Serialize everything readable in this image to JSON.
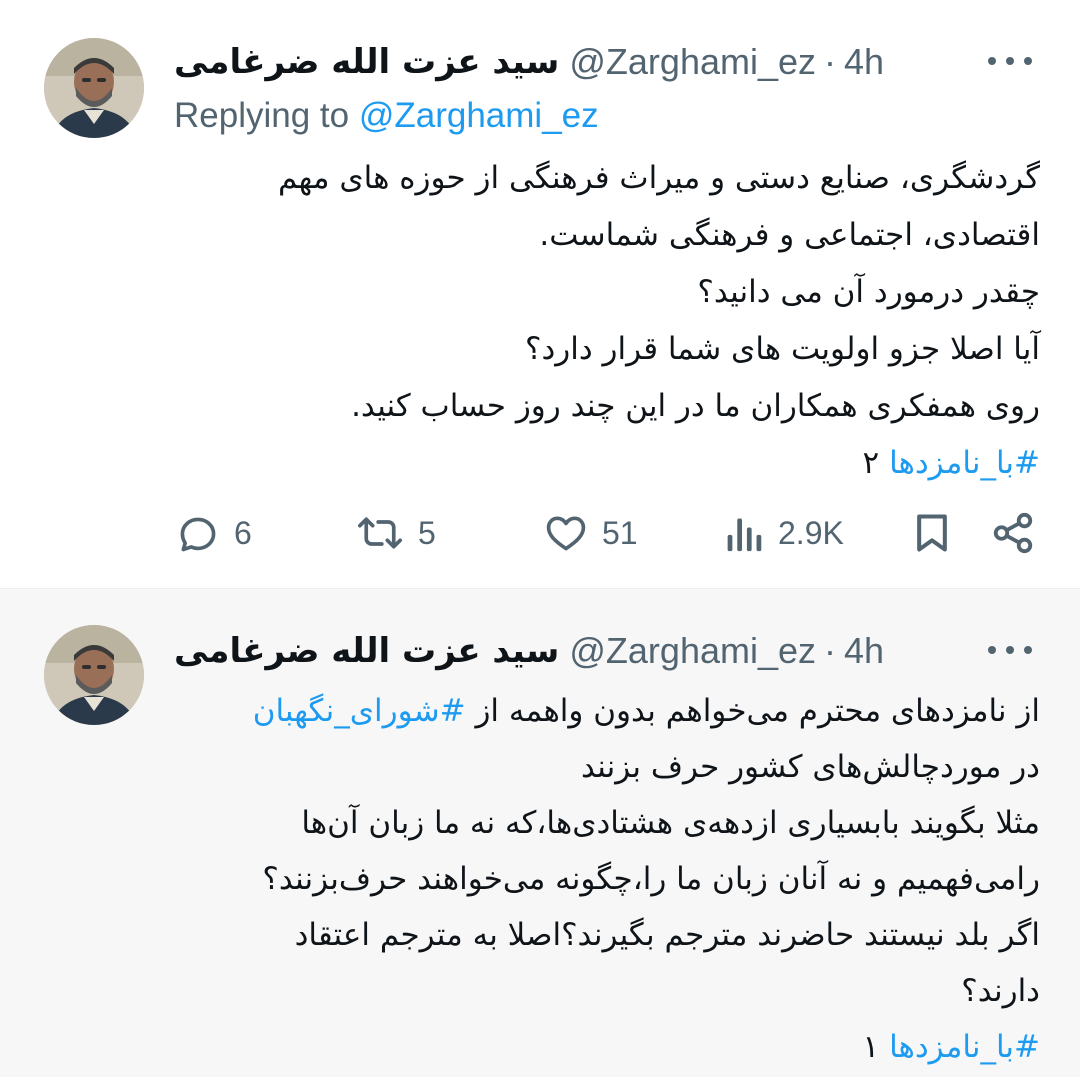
{
  "tweets": [
    {
      "author_name": "سید عزت الله ضرغامی",
      "handle": "@Zarghami_ez",
      "separator": "·",
      "time": "4h",
      "replying_prefix": "Replying to",
      "replying_handle": "@Zarghami_ez",
      "lines": [
        "گردشگری، صنایع دستی و میراث فرهنگی از حوزه های مهم",
        "اقتصادی، اجتماعی و فرهنگی شماست.",
        "چقدر درمورد آن می دانید؟",
        "آیا اصلا جزو اولویت های شما قرار دارد؟",
        "روی همفکری همکاران ما در این چند روز حساب کنید."
      ],
      "hashtag": "#با_نامزدها",
      "tag_number": "۲",
      "stats": {
        "replies": "6",
        "retweets": "5",
        "likes": "51",
        "views": "2.9K"
      }
    },
    {
      "author_name": "سید عزت الله ضرغامی",
      "handle": "@Zarghami_ez",
      "separator": "·",
      "time": "4h",
      "line1_text": "از نامزدهای محترم می‌خواهم بدون واهمه از ",
      "line1_hashtag": "#شورای_نگهبان",
      "lines": [
        "در موردچالش‌های کشور حرف بزنند",
        "مثلا بگویند بابسیاری ازدهه‌ی هشتادی‌ها،که نه ما زبان آن‌ها",
        "رامی‌فهمیم و نه آنان زبان ما را،چگونه می‌خواهند حرف‌بزنند؟",
        "اگر بلد نیستند حاضرند مترجم بگیرند؟اصلا به مترجم اعتقاد",
        "دارند؟"
      ],
      "hashtag": "#با_نامزدها",
      "tag_number": "۱"
    }
  ],
  "icons": {
    "more": "more-icon",
    "reply": "reply-icon",
    "retweet": "retweet-icon",
    "like": "like-icon",
    "views": "views-icon",
    "bookmark": "bookmark-icon",
    "share": "share-icon"
  },
  "colors": {
    "link": "#1d9bf0",
    "secondary_text": "#536471",
    "primary_text": "#0f1419",
    "second_tweet_bg": "#f7f7f8"
  }
}
